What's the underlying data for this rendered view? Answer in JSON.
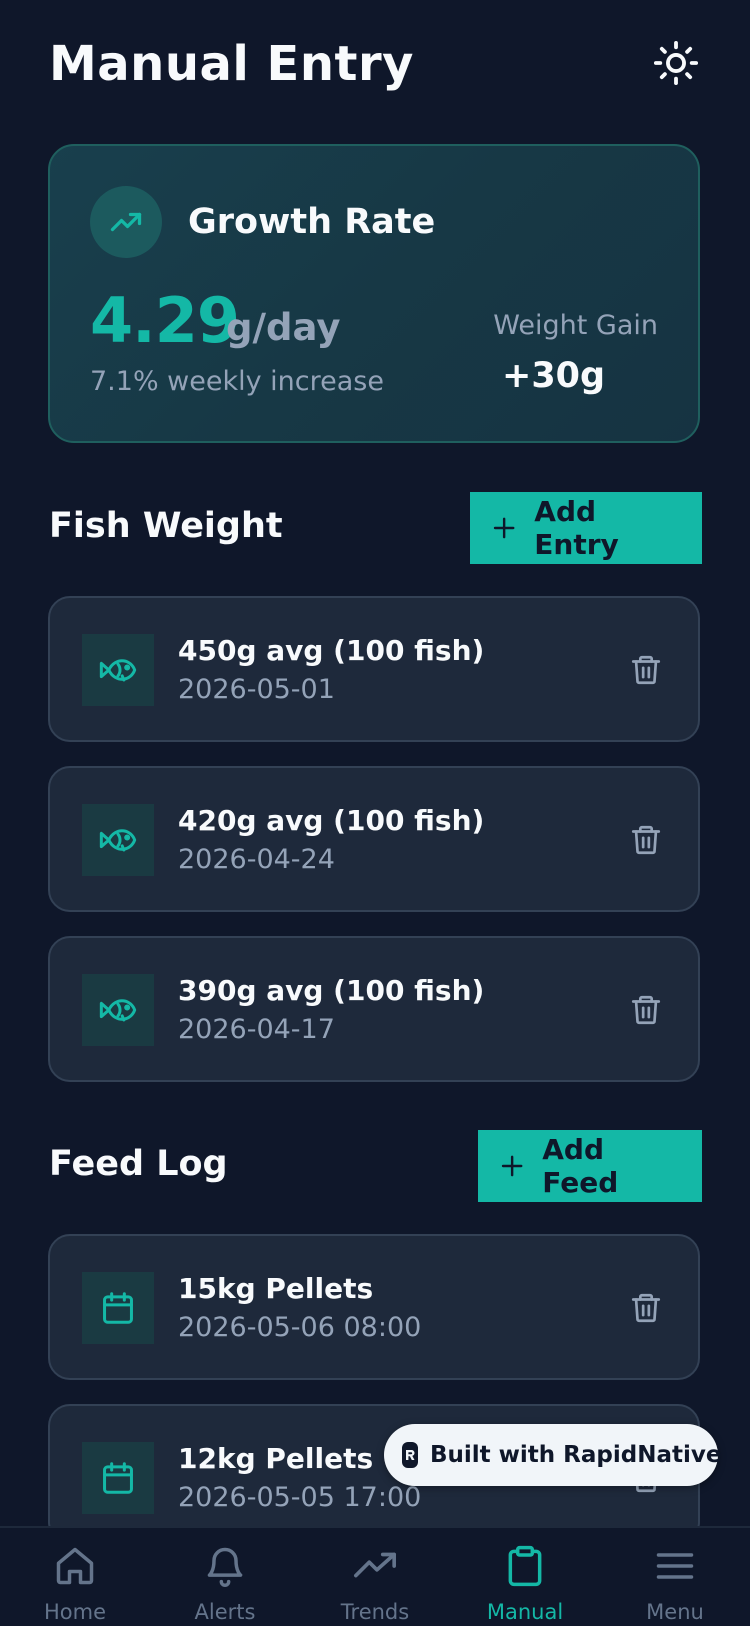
{
  "header": {
    "title": "Manual Entry",
    "theme_icon": "sun-icon"
  },
  "growth": {
    "title": "Growth Rate",
    "icon": "trending-up-icon",
    "value": "4.29",
    "unit": "g/day",
    "subtitle": "7.1% weekly increase",
    "gain_label": "Weight Gain",
    "gain_value": "+30g"
  },
  "fish_weight": {
    "title": "Fish Weight",
    "add_label": "Add Entry",
    "entries": [
      {
        "title": "450g avg (100 fish)",
        "date": "2026-05-01"
      },
      {
        "title": "420g avg (100 fish)",
        "date": "2026-04-24"
      },
      {
        "title": "390g avg (100 fish)",
        "date": "2026-04-17"
      }
    ]
  },
  "feed_log": {
    "title": "Feed Log",
    "add_label": "Add Feed",
    "entries": [
      {
        "title": "15kg Pellets",
        "date": "2026-05-06 08:00"
      },
      {
        "title": "12kg Pellets",
        "date": "2026-05-05 17:00"
      }
    ]
  },
  "badge": {
    "text": "Built with RapidNative"
  },
  "nav": {
    "items": [
      {
        "label": "Home",
        "icon": "home-icon",
        "active": false
      },
      {
        "label": "Alerts",
        "icon": "bell-icon",
        "active": false
      },
      {
        "label": "Trends",
        "icon": "trending-up-icon",
        "active": false
      },
      {
        "label": "Manual",
        "icon": "clipboard-icon",
        "active": true
      },
      {
        "label": "Menu",
        "icon": "menu-icon",
        "active": false
      }
    ]
  },
  "colors": {
    "background": "#0f172a",
    "accent": "#14b8a6",
    "card": "#1e293b",
    "muted_text": "#94a3b8"
  }
}
